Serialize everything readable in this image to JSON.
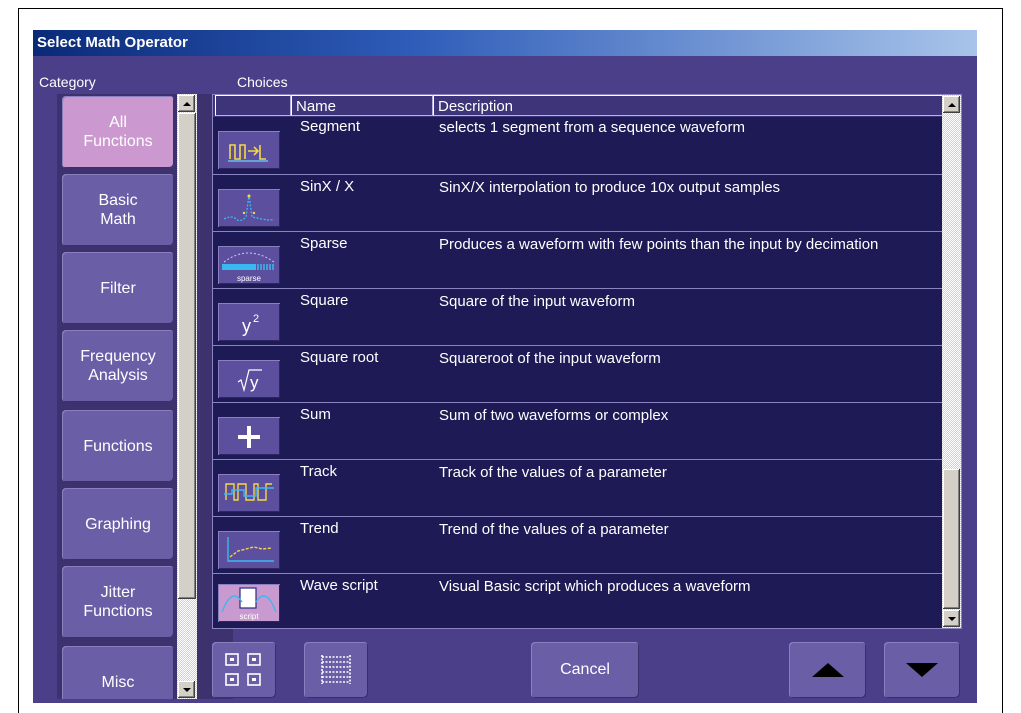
{
  "window": {
    "title": "Select Math Operator"
  },
  "labels": {
    "category": "Category",
    "choices": "Choices"
  },
  "categories": [
    {
      "label": "All\nFunctions",
      "active": true
    },
    {
      "label": "Basic\nMath",
      "active": false
    },
    {
      "label": "Filter",
      "active": false
    },
    {
      "label": "Frequency\nAnalysis",
      "active": false
    },
    {
      "label": "Functions",
      "active": false
    },
    {
      "label": "Graphing",
      "active": false
    },
    {
      "label": "Jitter\nFunctions",
      "active": false
    },
    {
      "label": "Misc",
      "active": false
    }
  ],
  "table": {
    "columns": [
      "",
      "Name",
      "Description"
    ],
    "rows": [
      {
        "icon": "segment-icon",
        "name": "Segment",
        "description": "selects 1 segment from a sequence waveform"
      },
      {
        "icon": "sinx-icon",
        "name": "SinX / X",
        "description": "SinX/X interpolation to produce 10x output samples"
      },
      {
        "icon": "sparse-icon",
        "icon_caption": "sparse",
        "name": "Sparse",
        "description": "Produces a waveform with few points than the input by decimation"
      },
      {
        "icon": "square-icon",
        "name": "Square",
        "description": "Square of the input waveform"
      },
      {
        "icon": "square-root-icon",
        "name": "Square root",
        "description": "Squareroot of the input waveform"
      },
      {
        "icon": "plus-icon",
        "name": "Sum",
        "description": "Sum of two waveforms or complex"
      },
      {
        "icon": "track-icon",
        "name": "Track",
        "description": "Track of the values of a parameter"
      },
      {
        "icon": "trend-icon",
        "name": "Trend",
        "description": "Trend of the values of a parameter"
      },
      {
        "icon": "script-icon",
        "icon_caption": "script",
        "name": "Wave script",
        "description": "Visual Basic script which produces a waveform"
      }
    ]
  },
  "buttons": {
    "icon_view": "grid-view-icon",
    "list_view": "list-view-icon",
    "cancel": "Cancel",
    "up": "arrow-up-icon",
    "down": "arrow-down-icon"
  },
  "colors": {
    "background": "#4a3f88",
    "table_bg": "#1e1a55",
    "active_category": "#cc98d0",
    "button": "#6a5ea6"
  }
}
